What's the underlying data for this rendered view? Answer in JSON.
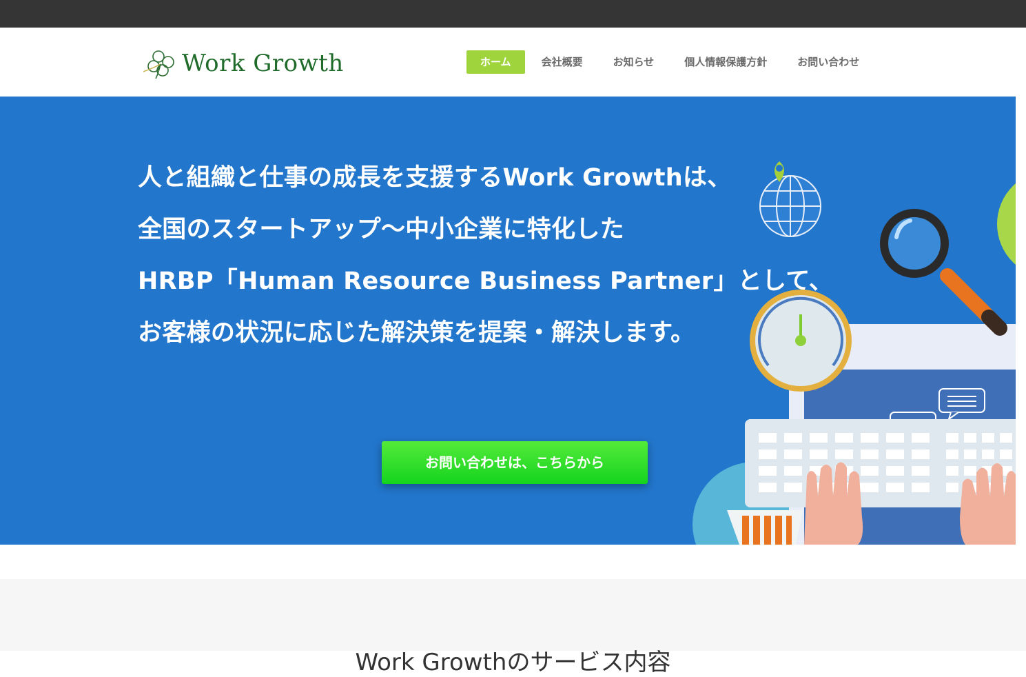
{
  "header": {
    "logo_text": "Work Growth",
    "nav": [
      {
        "label": "ホーム",
        "active": true
      },
      {
        "label": "会社概要",
        "active": false
      },
      {
        "label": "お知らせ",
        "active": false
      },
      {
        "label": "個人情報保護方針",
        "active": false
      },
      {
        "label": "お問い合わせ",
        "active": false
      }
    ]
  },
  "hero": {
    "lines": [
      "人と組織と仕事の成長を支援するWork Growthは、",
      "全国のスタートアップ〜中小企業に特化した",
      "HRBP「Human Resource Business Partner」として、",
      "お客様の状況に応じた解決策を提案・解決します。"
    ],
    "cta_label": "お問い合わせは、こちらから",
    "illustration_icons": [
      "globe-icon",
      "map-pin-icon",
      "magnifier-icon",
      "gauge-icon",
      "chat-bubble-icon",
      "keyboard-icon",
      "hands-icon",
      "cart-icon"
    ]
  },
  "section": {
    "title": "Work Growthのサービス内容"
  },
  "colors": {
    "topbar": "#353535",
    "accent": "#9fd43c",
    "hero_bg": "#2276cc",
    "cta": "#1fd41e",
    "logo": "#1f6b2a"
  }
}
